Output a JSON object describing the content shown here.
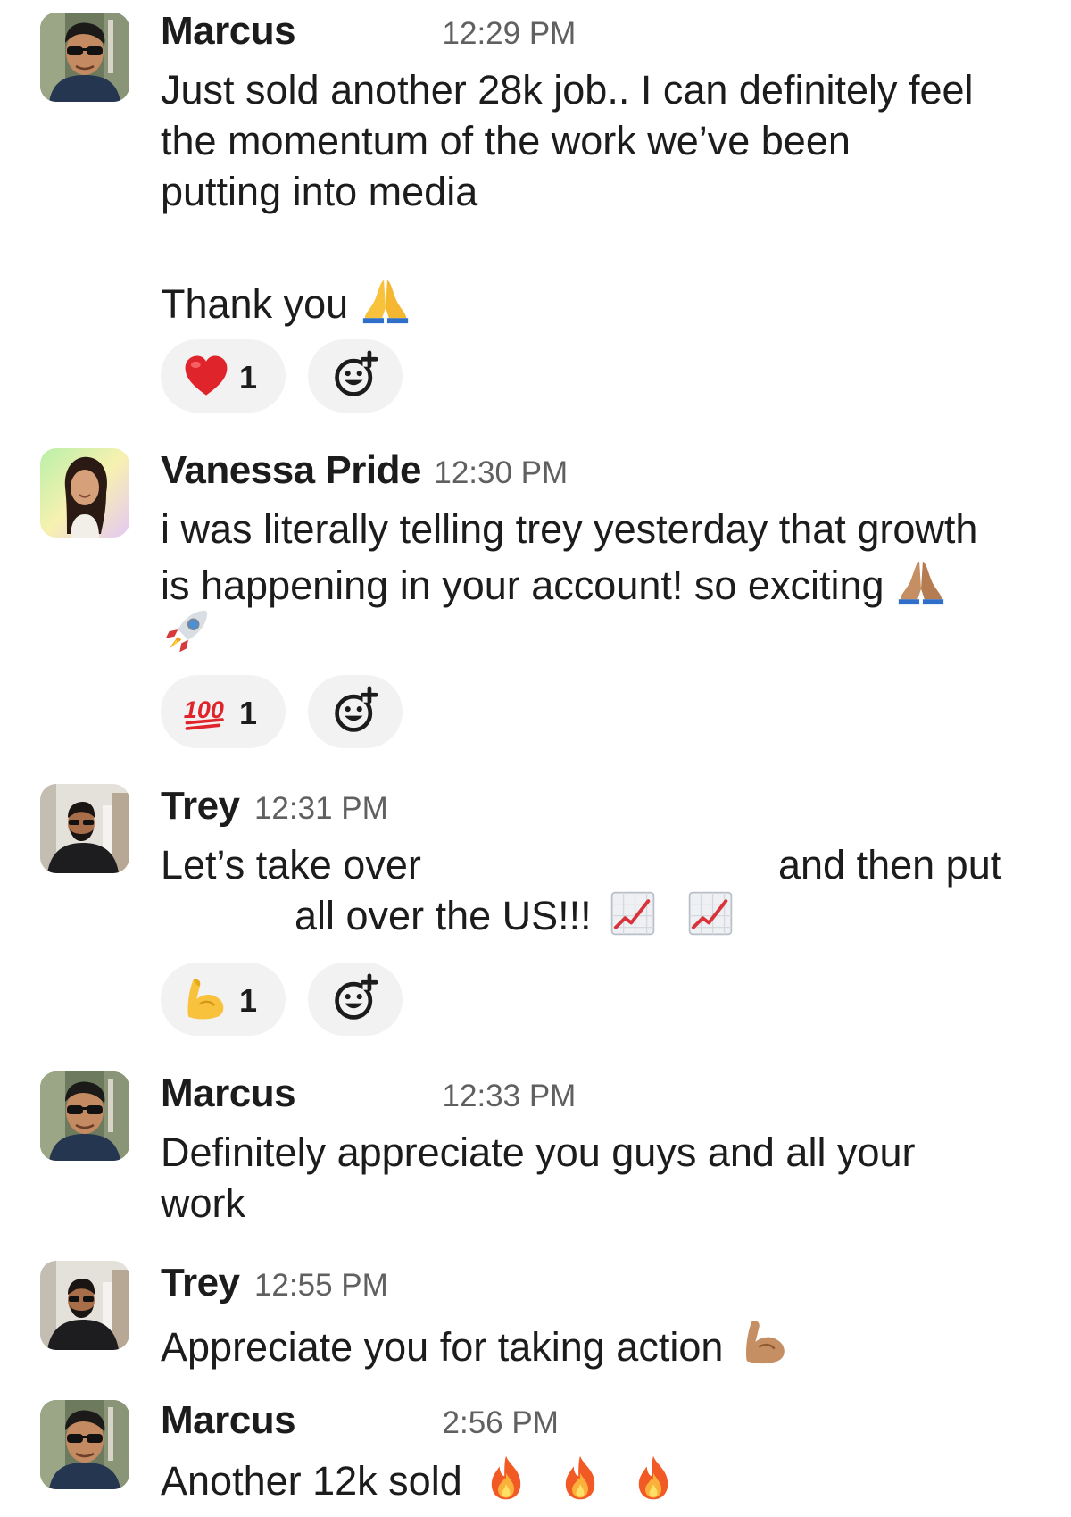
{
  "messages": [
    {
      "author": "Marcus",
      "time": "12:29 PM",
      "avatar_icon": "marcus-avatar",
      "lines": [
        "Just sold another 28k job.. I can definitely feel",
        "the momentum of the work we’ve been",
        "putting into media",
        "",
        "Thank you"
      ],
      "trailing_emoji": "folded-hands-icon",
      "reaction": {
        "emoji": "red-heart-icon",
        "count": "1"
      },
      "add_reaction_icon": "add-reaction-icon"
    },
    {
      "author": "Vanessa Pride",
      "time": "12:30 PM",
      "avatar_icon": "vanessa-avatar",
      "lines": [
        "i was literally telling trey yesterday that growth",
        "is happening in your account! so exciting"
      ],
      "trailing_emoji": "folded-hands-medium-skin-icon",
      "second_line_emoji": "rocket-icon",
      "reaction": {
        "emoji": "hundred-points-icon",
        "count": "1"
      },
      "add_reaction_icon": "add-reaction-icon"
    },
    {
      "author": "Trey",
      "time": "12:31 PM",
      "avatar_icon": "trey-avatar",
      "lines": [
        "Let’s take over",
        "and then put",
        "all over the US!!!"
      ],
      "trailing_emoji": "chart-increasing-icon",
      "reaction": {
        "emoji": "flexed-biceps-icon",
        "count": "1"
      },
      "add_reaction_icon": "add-reaction-icon"
    },
    {
      "author": "Marcus",
      "time": "12:33 PM",
      "avatar_icon": "marcus-avatar",
      "lines": [
        "Definitely appreciate you guys and all your",
        "work"
      ]
    },
    {
      "author": "Trey",
      "time": "12:55 PM",
      "avatar_icon": "trey-avatar",
      "lines": [
        "Appreciate you for taking action"
      ],
      "trailing_emoji": "flexed-biceps-medium-skin-icon"
    },
    {
      "author": "Marcus",
      "time": "2:56 PM",
      "avatar_icon": "marcus-avatar",
      "lines": [
        "Another 12k sold"
      ],
      "trailing_emoji": "fire-icon"
    }
  ],
  "colors": {
    "text": "#1d1c1d",
    "timestamp": "#616061",
    "reaction_bg": "#f2f2f2"
  }
}
